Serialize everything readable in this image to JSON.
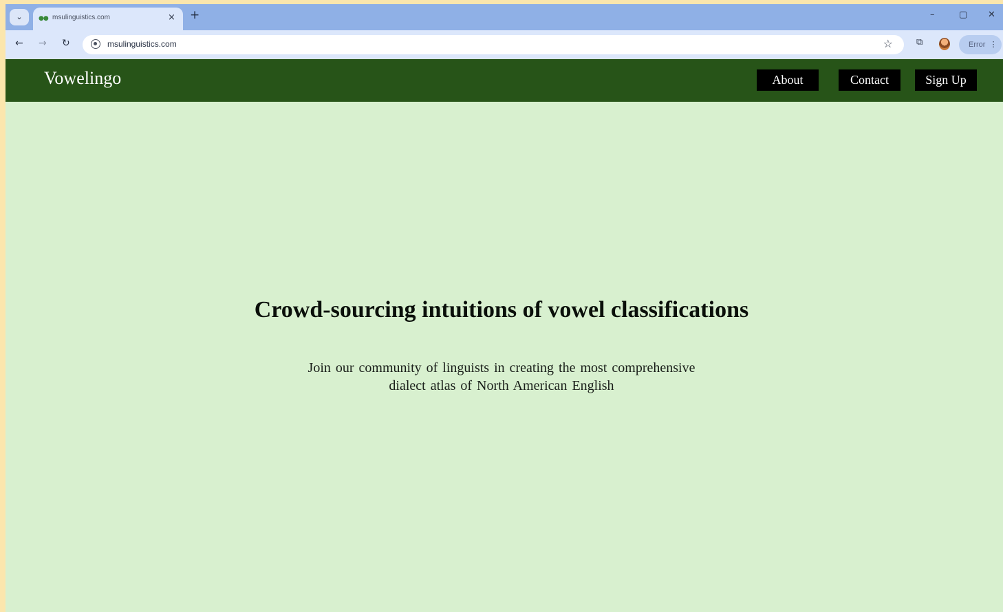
{
  "browser": {
    "tab_title": "msulinguistics.com",
    "url": "msulinguistics.com",
    "new_tab_glyph": "+",
    "close_tab_glyph": "×",
    "profile_label": "Error",
    "icons": {
      "tab_search": "chevron-down-icon",
      "back": "arrow-left-icon",
      "forward": "arrow-right-icon",
      "reload": "reload-icon",
      "site_info": "site-info-icon",
      "bookmark": "star-icon",
      "extensions": "extensions-icon",
      "menu": "kebab-menu-icon"
    },
    "colors": {
      "tab_strip": "#8fb0e6",
      "toolbar": "#dce7fb"
    }
  },
  "site": {
    "logo": "Vowelingo",
    "nav": {
      "about": "About",
      "contact": "Contact",
      "signup": "Sign Up"
    },
    "hero": {
      "title": "Crowd-sourcing intuitions of vowel classifications",
      "subtitle_line1": "Join our community of linguists in creating the most comprehensive",
      "subtitle_line2": "dialect atlas of North American English"
    },
    "colors": {
      "header_bg": "#275418",
      "page_bg": "#d8f0cf",
      "button_bg": "#000000"
    }
  }
}
